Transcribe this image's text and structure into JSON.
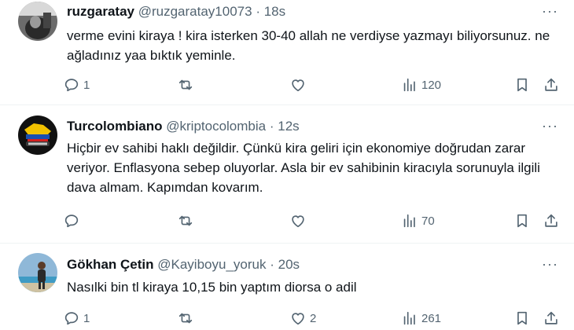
{
  "tweets": [
    {
      "display_name": "ruzgaratay",
      "handle": "@ruzgaratay10073",
      "separator": "·",
      "time": "18s",
      "text": "verme evini kiraya ! kira isterken 30-40 allah ne verdiyse yazmayı biliyorsunuz. ne ağladınız yaa bıktık yeminle.",
      "replies": "1",
      "retweets": "",
      "likes": "",
      "views": "120"
    },
    {
      "display_name": "Turcolombiano",
      "handle": "@kriptocolombia",
      "separator": "·",
      "time": "12s",
      "text": "Hiçbir ev sahibi haklı değildir. Çünkü kira geliri için ekonomiye doğrudan zarar veriyor. Enflasyona sebep oluyorlar. Asla bir ev sahibinin kiracıyla sorunuyla ilgili dava almam. Kapımdan kovarım.",
      "replies": "",
      "retweets": "",
      "likes": "",
      "views": "70"
    },
    {
      "display_name": "Gökhan Çetin",
      "handle": "@Kayiboyu_yoruk",
      "separator": "·",
      "time": "20s",
      "text": "Nasılki bin tl kiraya 10,15 bin yaptım diorsa o adil",
      "replies": "1",
      "retweets": "",
      "likes": "2",
      "views": "261"
    }
  ],
  "more_label": "···",
  "colors": {
    "text": "#0f1419",
    "secondary": "#536471",
    "divider": "#eff3f4"
  }
}
